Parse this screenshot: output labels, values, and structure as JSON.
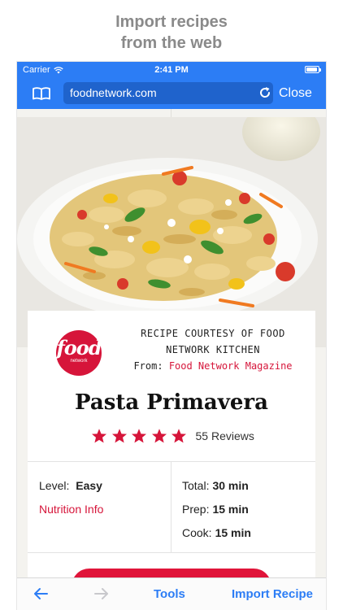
{
  "caption": {
    "line1": "Import recipes",
    "line2": "from the web"
  },
  "statusbar": {
    "carrier": "Carrier",
    "time": "2:41 PM"
  },
  "navbar": {
    "url": "foodnetwork.com",
    "close_label": "Close"
  },
  "recipe": {
    "logo_text": "food",
    "logo_subtext": "network",
    "courtesy_line1": "RECIPE COURTESY OF FOOD",
    "courtesy_line2": "NETWORK KITCHEN",
    "from_label": "From:",
    "from_source": "Food Network Magazine",
    "title": "Pasta Primavera",
    "rating_stars": 5,
    "reviews": "55 Reviews",
    "level_label": "Level:",
    "level_value": "Easy",
    "nutrition_label": "Nutrition Info",
    "times": [
      {
        "label": "Total:",
        "value": "30 min"
      },
      {
        "label": "Prep:",
        "value": "15 min"
      },
      {
        "label": "Cook:",
        "value": "15 min"
      }
    ]
  },
  "toolbar": {
    "tools_label": "Tools",
    "import_label": "Import Recipe"
  },
  "colors": {
    "accent_blue": "#2c7df5",
    "brand_red": "#d6153a"
  },
  "icons": [
    "wifi-icon",
    "battery-icon",
    "book-icon",
    "reload-icon",
    "back-arrow-icon",
    "forward-arrow-icon",
    "star-icon"
  ]
}
